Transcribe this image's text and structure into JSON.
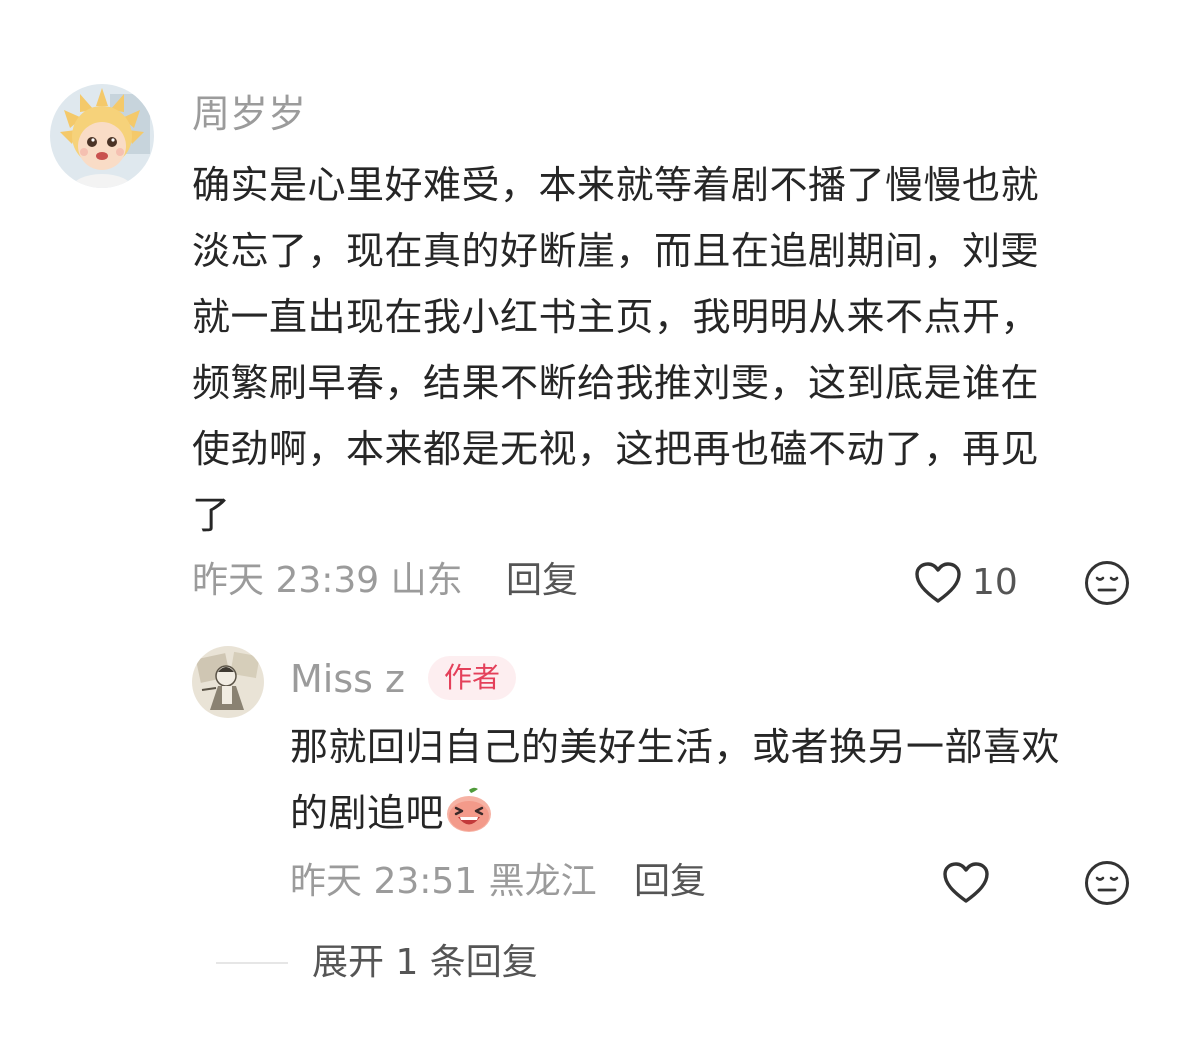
{
  "comment": {
    "username": "周岁岁",
    "lines": [
      "确实是心里好难受，本来就等着剧不播了慢慢也就",
      "淡忘了，现在真的好断崖，而且在追剧期间，刘雯",
      "就一直出现在我小红书主页，我明明从来不点开，",
      "频繁刷早春，结果不断给我推刘雯，这到底是谁在",
      "使劲啊，本来都是无视，这把再也磕不动了，再见",
      "了"
    ],
    "time": "昨天 23:39",
    "location": "山东",
    "reply_label": "回复",
    "like_count": "10",
    "avatar_icon": "cartoon-baby-avatar",
    "like_icon": "heart-outline-icon",
    "dislike_icon": "meh-face-icon"
  },
  "reply": {
    "username": "Miss z",
    "badge": "作者",
    "lines": [
      "那就回归自己的美好生活，或者换另一部喜欢",
      "的剧追吧"
    ],
    "emoji_icon": "laughing-peach-emoji",
    "time": "昨天 23:51",
    "location": "黑龙江",
    "reply_label": "回复",
    "avatar_icon": "sketch-figure-avatar",
    "like_icon": "heart-outline-icon",
    "dislike_icon": "meh-face-icon"
  },
  "expand": {
    "label": "展开 1 条回复"
  },
  "colors": {
    "badge_bg": "#fdeef0",
    "badge_text": "#e4405a",
    "muted": "#9b9b9b",
    "text": "#262626"
  }
}
